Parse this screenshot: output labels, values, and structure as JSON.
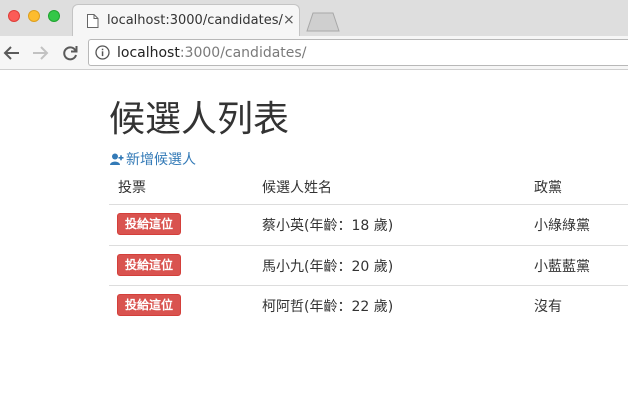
{
  "browser": {
    "tab_title": "localhost:3000/candidates/",
    "tab_close": "×",
    "url_host": "localhost",
    "url_rest": ":3000/candidates/"
  },
  "page": {
    "title": "候選人列表",
    "add_link": "新增候選人"
  },
  "table": {
    "headers": {
      "vote": "投票",
      "name": "候選人姓名",
      "party": "政黨"
    },
    "rows": [
      {
        "vote_label": "投給這位",
        "name": "蔡小英(年齡：18 歲)",
        "party": "小綠綠黨"
      },
      {
        "vote_label": "投給這位",
        "name": "馬小九(年齡：20 歲)",
        "party": "小藍藍黨"
      },
      {
        "vote_label": "投給這位",
        "name": "柯阿哲(年齡：22 歲)",
        "party": "沒有"
      }
    ]
  },
  "colors": {
    "link": "#337ab7",
    "danger": "#d9534f",
    "text": "#333333",
    "border": "#dddddd"
  }
}
